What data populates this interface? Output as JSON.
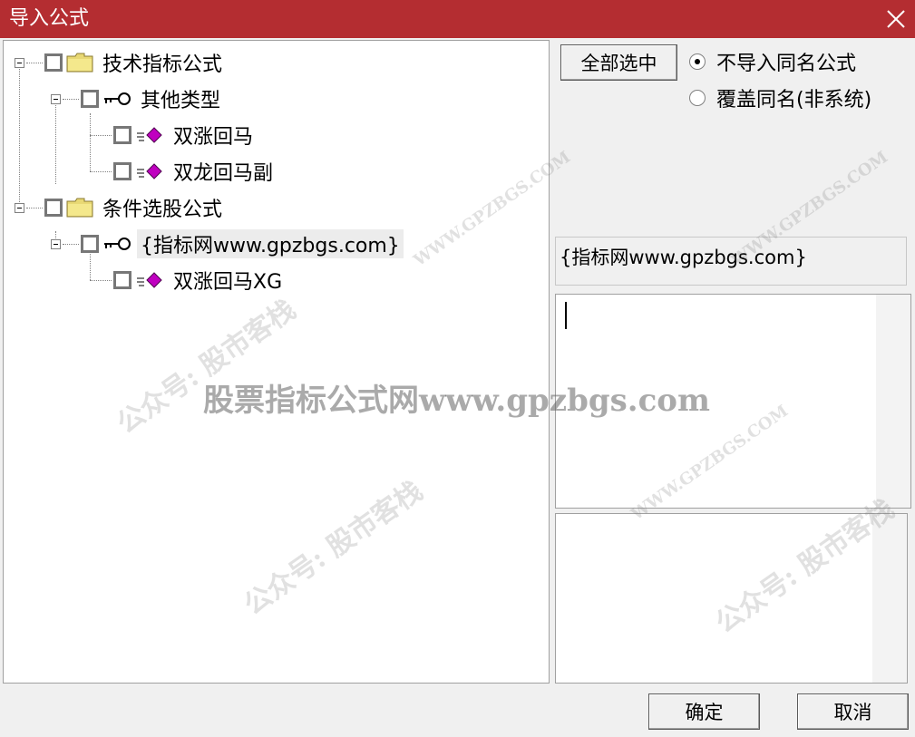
{
  "window": {
    "title": "导入公式"
  },
  "tree": {
    "items": [
      {
        "label": "技术指标公式"
      },
      {
        "label": "其他类型"
      },
      {
        "label": "双涨回马"
      },
      {
        "label": "双龙回马副"
      },
      {
        "label": "条件选股公式"
      },
      {
        "label": "{指标网www.gpzbgs.com}"
      },
      {
        "label": "双涨回马XG"
      }
    ]
  },
  "options": {
    "select_all_label": "全部选中",
    "radio_no_import_label": "不导入同名公式",
    "radio_overwrite_label": "覆盖同名(非系统)",
    "selected": "不导入同名公式"
  },
  "info": {
    "text": "{指标网www.gpzbgs.com}"
  },
  "buttons": {
    "ok_label": "确定",
    "cancel_label": "取消"
  },
  "watermark": {
    "center": "股票指标公式网www.gpzbgs.com",
    "site": "WWW.GPZBGS.COM",
    "account": "公众号: 股市客栈"
  },
  "colors": {
    "titlebar": "#b42d31",
    "folder": "#e8d874",
    "formula_icon": "#c000c0"
  }
}
